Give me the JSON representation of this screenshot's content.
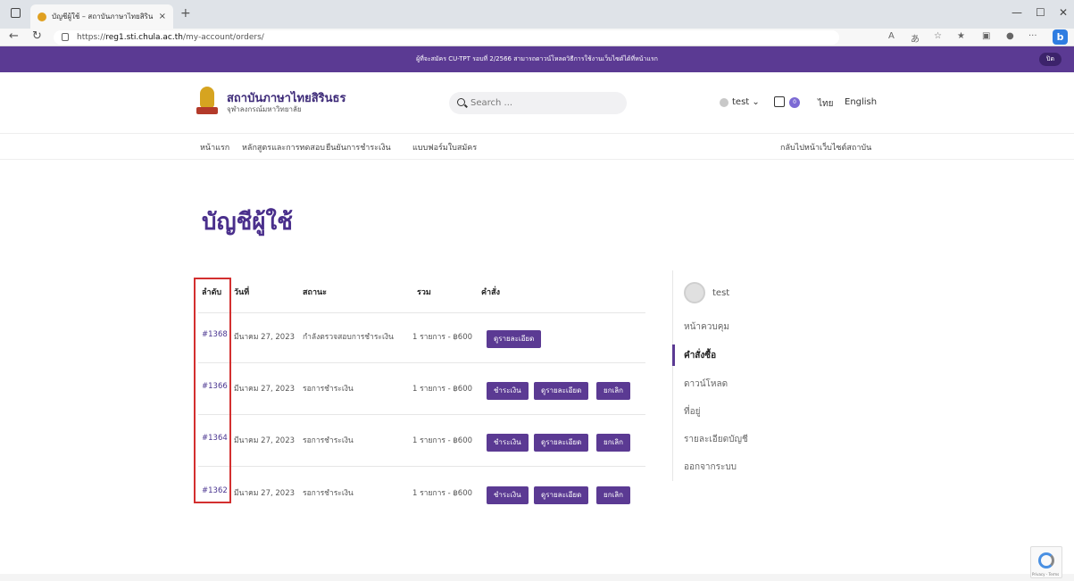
{
  "browser": {
    "tab_title": "บัญชีผู้ใช้ – สถาบันภาษาไทยสิรินธร",
    "url_prefix": "https://",
    "url_host": "reg1.sti.chula.ac.th",
    "url_path": "/my-account/orders/",
    "tab_close": "×",
    "new_tab": "+",
    "minimize": "—",
    "maximize": "☐",
    "close": "✕"
  },
  "announcement": {
    "text": "ผู้ที่จะสมัคร CU-TPT รอบที่ 2/2566 สามารถดาวน์โหลดวิธีการใช้งานเว็บไซต์ได้ที่หน้าแรก",
    "close_label": "ปิด"
  },
  "header": {
    "brand_name": "สถาบันภาษาไทยสิรินธร",
    "brand_sub": "จุฬาลงกรณ์มหาวิทยาลัย",
    "search_placeholder": "Search ...",
    "user_label": "test ⌄",
    "cart_count": "0",
    "lang_th": "ไทย",
    "lang_en": "English"
  },
  "menu": {
    "items": [
      "หน้าแรก",
      "หลักสูตรและการทดสอบ",
      "ยืนยันการชำระเงิน",
      "แบบฟอร์มใบสมัคร"
    ],
    "right": "กลับไปหน้าเว็บไซต์สถาบัน"
  },
  "page": {
    "title": "บัญชีผู้ใช้"
  },
  "orders": {
    "headers": [
      "ลำดับ",
      "วันที่",
      "สถานะ",
      "รวม",
      "คำสั่ง"
    ],
    "rows": [
      {
        "number": "#1368",
        "date": "มีนาคม 27, 2023",
        "status": "กำลังตรวจสอบการชำระเงิน",
        "total": "1 รายการ - ฿600",
        "actions": [
          "ดูรายละเอียด"
        ]
      },
      {
        "number": "#1366",
        "date": "มีนาคม 27, 2023",
        "status": "รอการชำระเงิน",
        "total": "1 รายการ - ฿600",
        "actions": [
          "ชำระเงิน",
          "ดูรายละเอียด",
          "ยกเลิก"
        ]
      },
      {
        "number": "#1364",
        "date": "มีนาคม 27, 2023",
        "status": "รอการชำระเงิน",
        "total": "1 รายการ - ฿600",
        "actions": [
          "ชำระเงิน",
          "ดูรายละเอียด",
          "ยกเลิก"
        ]
      },
      {
        "number": "#1362",
        "date": "มีนาคม 27, 2023",
        "status": "รอการชำระเงิน",
        "total": "1 รายการ - ฿600",
        "actions": [
          "ชำระเงิน",
          "ดูรายละเอียด",
          "ยกเลิก"
        ]
      }
    ]
  },
  "sidebar": {
    "username": "test",
    "items": [
      "หน้าควบคุม",
      "คำสั่งซื้อ",
      "ดาวน์โหลด",
      "ที่อยู่",
      "รายละเอียดบัญชี",
      "ออกจากระบบ"
    ],
    "active_index": 1
  },
  "recaptcha": {
    "text": "Privacy - Terms"
  },
  "colors": {
    "brand": "#5b3a93",
    "highlight": "#d32f2f"
  }
}
